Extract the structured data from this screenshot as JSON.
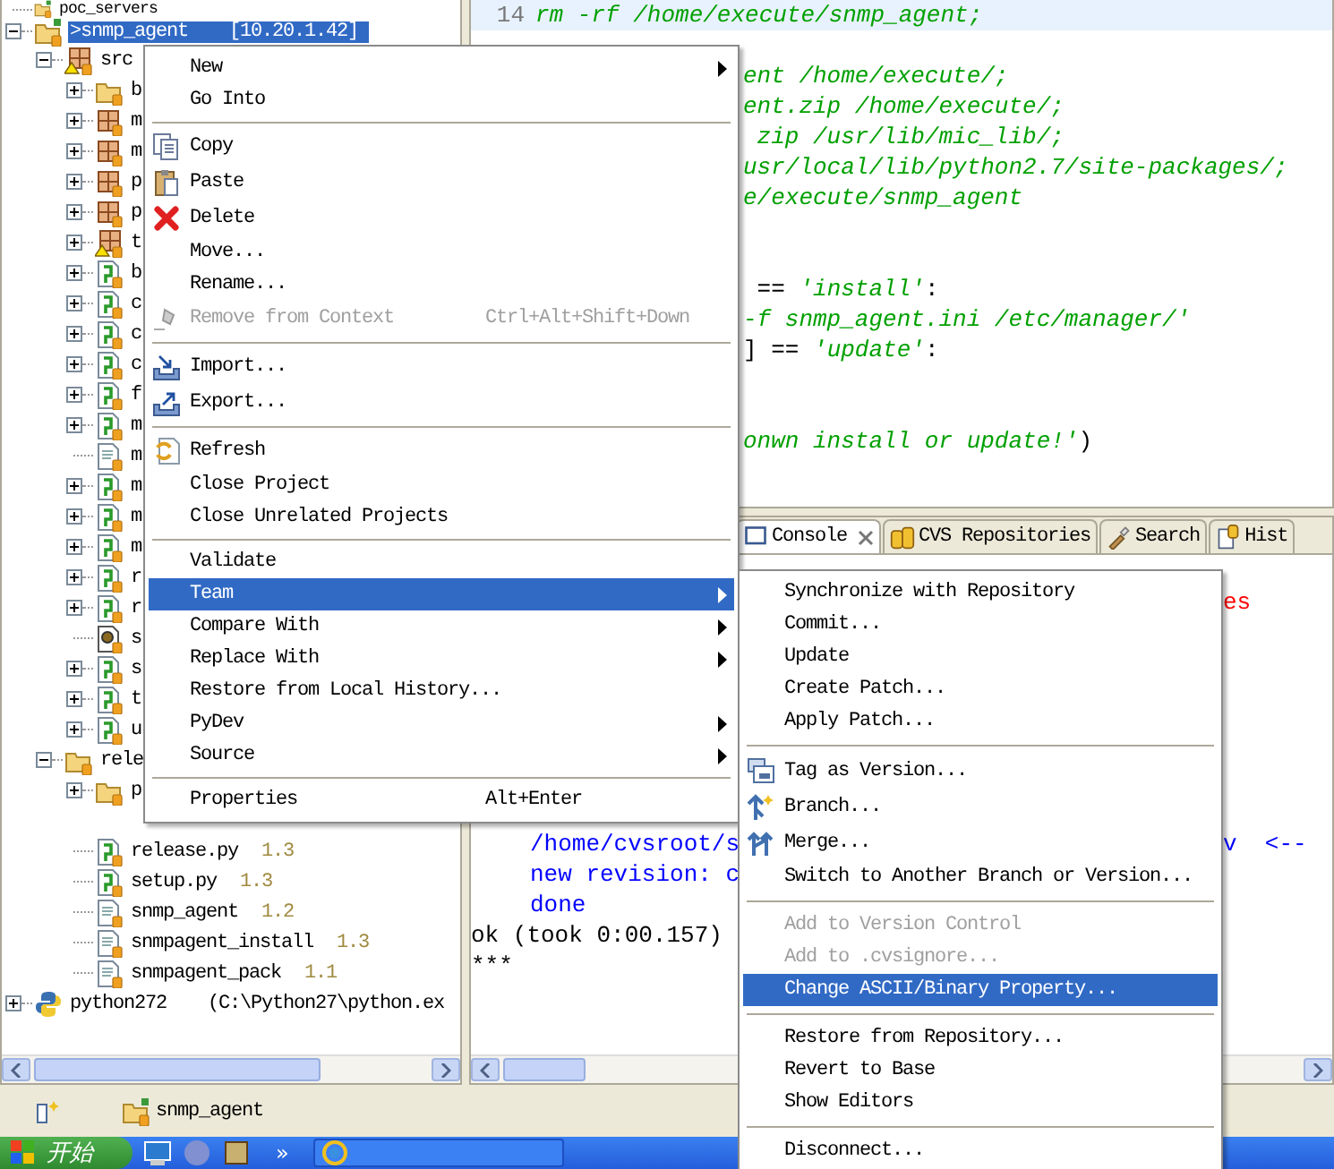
{
  "project_tree": {
    "items": [
      {
        "name": "poc_servers",
        "kind": "project",
        "selected": false
      },
      {
        "name": ">snmp_agent",
        "location": "[10.20.1.42]",
        "kind": "project",
        "expanded": true,
        "selected": true,
        "children": [
          {
            "name": "src",
            "kind": "package_warning",
            "expanded": true,
            "selected": false,
            "children": [
              {
                "name": "b",
                "kind": "folder",
                "expanded": false,
                "selected": false
              },
              {
                "name": "m",
                "kind": "package",
                "expanded": false,
                "selected": false
              },
              {
                "name": "m",
                "kind": "package",
                "expanded": false,
                "selected": false
              },
              {
                "name": "p",
                "kind": "package",
                "expanded": false,
                "selected": false
              },
              {
                "name": "p",
                "kind": "package",
                "expanded": false,
                "selected": false
              },
              {
                "name": "t",
                "kind": "package_warning",
                "expanded": false,
                "selected": false
              },
              {
                "name": "b",
                "kind": "module",
                "expanded": false,
                "selected": false
              },
              {
                "name": "c",
                "kind": "module",
                "expanded": false,
                "selected": false
              },
              {
                "name": "c",
                "kind": "module",
                "expanded": false,
                "selected": false
              },
              {
                "name": "c",
                "kind": "module",
                "expanded": false,
                "selected": false
              },
              {
                "name": "f",
                "kind": "module",
                "expanded": false,
                "selected": false
              },
              {
                "name": "m",
                "kind": "module",
                "expanded": false,
                "selected": false
              },
              {
                "name": "m",
                "kind": "file",
                "selected": false
              },
              {
                "name": "m",
                "kind": "module",
                "expanded": false,
                "selected": false
              },
              {
                "name": "m",
                "kind": "module",
                "expanded": false,
                "selected": false
              },
              {
                "name": "m",
                "kind": "module",
                "expanded": false,
                "selected": false
              },
              {
                "name": "r",
                "kind": "module",
                "expanded": false,
                "selected": false
              },
              {
                "name": "r",
                "kind": "module",
                "expanded": false,
                "selected": false
              },
              {
                "name": "s",
                "kind": "gear_file",
                "selected": false
              },
              {
                "name": "s",
                "kind": "module",
                "expanded": false,
                "selected": false
              },
              {
                "name": "t",
                "kind": "module",
                "expanded": false,
                "selected": false
              },
              {
                "name": "u",
                "kind": "module",
                "expanded": false,
                "selected": false
              }
            ]
          },
          {
            "name": "rele",
            "kind": "folder",
            "expanded": true,
            "selected": false,
            "children": [
              {
                "name": "p",
                "kind": "folder",
                "expanded": false,
                "selected": false
              },
              {
                "kind": "covered"
              },
              {
                "name": "release.py",
                "version": "1.3",
                "kind": "module",
                "selected": false
              },
              {
                "name": "setup.py",
                "version": "1.3",
                "kind": "module",
                "selected": false
              },
              {
                "name": "snmp_agent",
                "version": "1.2",
                "kind": "file",
                "selected": false
              },
              {
                "name": "snmpagent_install",
                "version": "1.3",
                "kind": "file",
                "selected": false
              },
              {
                "name": "snmpagent_pack",
                "version": "1.1",
                "kind": "file",
                "selected": false
              }
            ]
          }
        ]
      },
      {
        "name": "python272",
        "location": "(C:\\Python27\\python.ex",
        "kind": "python",
        "expanded": false,
        "selected": false
      }
    ]
  },
  "editor": {
    "lines": [
      {
        "kind": "current",
        "number": "14",
        "segments": [
          {
            "text": "rm -rf /home/execute/snmp_agent;",
            "kind": "string"
          }
        ]
      },
      {
        "kind": "blank"
      },
      {
        "kind": "clipped",
        "segments": [
          {
            "text": "ent /home/execute/;",
            "kind": "string"
          }
        ]
      },
      {
        "kind": "clipped",
        "segments": [
          {
            "text": "ent.zip /home/execute/;",
            "kind": "string"
          }
        ]
      },
      {
        "kind": "clipped",
        "segments": [
          {
            "text": " zip /usr/lib/mic_lib/;",
            "kind": "string"
          }
        ]
      },
      {
        "kind": "clipped",
        "segments": [
          {
            "text": "usr/local/lib/python2.7/site-packages/;",
            "kind": "string"
          }
        ]
      },
      {
        "kind": "clipped",
        "segments": [
          {
            "text": "e/execute/snmp_agent",
            "kind": "string"
          }
        ]
      },
      {
        "kind": "blank"
      },
      {
        "kind": "blank"
      },
      {
        "kind": "clipped",
        "segments": [
          {
            "text": " == ",
            "kind": "op"
          },
          {
            "text": "'install'",
            "kind": "string"
          },
          {
            "text": ":",
            "kind": "op"
          }
        ]
      },
      {
        "kind": "clipped",
        "segments": [
          {
            "text": "-f snmp_agent.ini /etc/manager/'",
            "kind": "string"
          }
        ]
      },
      {
        "kind": "clipped",
        "segments": [
          {
            "text": "] == ",
            "kind": "op"
          },
          {
            "text": "'update'",
            "kind": "string"
          },
          {
            "text": ":",
            "kind": "op"
          }
        ]
      },
      {
        "kind": "blank"
      },
      {
        "kind": "blank"
      },
      {
        "kind": "clipped",
        "segments": [
          {
            "text": "onwn install or update!'",
            "kind": "string"
          },
          {
            "text": ")",
            "kind": "op"
          }
        ]
      }
    ]
  },
  "console_view": {
    "tabs": [
      {
        "label": "Console",
        "kind": "console",
        "closable": true,
        "selected": true
      },
      {
        "label": "CVS Repositories",
        "kind": "repository",
        "closable": false,
        "selected": false
      },
      {
        "label": "Search",
        "kind": "search",
        "closable": false,
        "selected": false
      },
      {
        "label": "Hist",
        "kind": "history",
        "closable": false,
        "selected": false
      }
    ],
    "upper_lines": [
      {
        "segments": [
          {
            "text": "es",
            "kind": "right",
            "color": "#ff0000"
          }
        ]
      }
    ],
    "lower_lines": [
      {
        "segments": [
          {
            "text": "/home/cvsroot/s",
            "kind": "indent",
            "color": "#0000ff"
          },
          {
            "text": "v  <--",
            "kind": "right",
            "color": "#0000ff"
          }
        ]
      },
      {
        "segments": [
          {
            "text": "new revision: c",
            "kind": "indent",
            "color": "#0000ff"
          }
        ]
      },
      {
        "segments": [
          {
            "text": "done",
            "kind": "indent",
            "color": "#0000ff"
          }
        ]
      },
      {
        "segments": [
          {
            "text": "ok (took 0:00.157)",
            "kind": "start",
            "color": "#000000"
          }
        ]
      },
      {
        "segments": [
          {
            "text": "***",
            "kind": "start",
            "color": "#000000"
          }
        ]
      }
    ]
  },
  "context_menu": {
    "items": [
      {
        "kind": "plain",
        "label": "New",
        "submenu": true,
        "disabled": false,
        "selected": false
      },
      {
        "kind": "plain",
        "label": "Go Into",
        "submenu": false,
        "disabled": false,
        "selected": false
      },
      {
        "kind": "separator"
      },
      {
        "kind": "copy",
        "label": "Copy",
        "submenu": false,
        "disabled": false,
        "selected": false
      },
      {
        "kind": "paste",
        "label": "Paste",
        "submenu": false,
        "disabled": false,
        "selected": false
      },
      {
        "kind": "delete",
        "label": "Delete",
        "submenu": false,
        "disabled": false,
        "selected": false
      },
      {
        "kind": "plain",
        "label": "Move...",
        "submenu": false,
        "disabled": false,
        "selected": false
      },
      {
        "kind": "plain",
        "label": "Rename...",
        "submenu": false,
        "disabled": false,
        "selected": false
      },
      {
        "kind": "remove",
        "label": "Remove from Context",
        "shortcut": "Ctrl+Alt+Shift+Down",
        "submenu": false,
        "disabled": true,
        "selected": false
      },
      {
        "kind": "separator"
      },
      {
        "kind": "import",
        "label": "Import...",
        "submenu": false,
        "disabled": false,
        "selected": false
      },
      {
        "kind": "export",
        "label": "Export...",
        "submenu": false,
        "disabled": false,
        "selected": false
      },
      {
        "kind": "separator"
      },
      {
        "kind": "refresh",
        "label": "Refresh",
        "submenu": false,
        "disabled": false,
        "selected": false
      },
      {
        "kind": "plain",
        "label": "Close Project",
        "submenu": false,
        "disabled": false,
        "selected": false
      },
      {
        "kind": "plain",
        "label": "Close Unrelated Projects",
        "submenu": false,
        "disabled": false,
        "selected": false
      },
      {
        "kind": "separator"
      },
      {
        "kind": "plain",
        "label": "Validate",
        "submenu": false,
        "disabled": false,
        "selected": false
      },
      {
        "kind": "plain",
        "label": "Team",
        "submenu": true,
        "disabled": false,
        "selected": true
      },
      {
        "kind": "plain",
        "label": "Compare With",
        "submenu": true,
        "disabled": false,
        "selected": false
      },
      {
        "kind": "plain",
        "label": "Replace With",
        "submenu": true,
        "disabled": false,
        "selected": false
      },
      {
        "kind": "plain",
        "label": "Restore from Local History...",
        "submenu": false,
        "disabled": false,
        "selected": false
      },
      {
        "kind": "plain",
        "label": "PyDev",
        "submenu": true,
        "disabled": false,
        "selected": false
      },
      {
        "kind": "plain",
        "label": "Source",
        "submenu": true,
        "disabled": false,
        "selected": false
      },
      {
        "kind": "separator"
      },
      {
        "kind": "plain",
        "label": "Properties",
        "shortcut": "Alt+Enter",
        "submenu": false,
        "disabled": false,
        "selected": false
      }
    ]
  },
  "team_submenu": {
    "items": [
      {
        "kind": "plain",
        "label": "Synchronize with Repository",
        "submenu": false,
        "disabled": false,
        "selected": false
      },
      {
        "kind": "plain",
        "label": "Commit...",
        "submenu": false,
        "disabled": false,
        "selected": false
      },
      {
        "kind": "plain",
        "label": "Update",
        "submenu": false,
        "disabled": false,
        "selected": false
      },
      {
        "kind": "plain",
        "label": "Create Patch...",
        "submenu": false,
        "disabled": false,
        "selected": false
      },
      {
        "kind": "plain",
        "label": "Apply Patch...",
        "submenu": false,
        "disabled": false,
        "selected": false
      },
      {
        "kind": "separator"
      },
      {
        "kind": "tag",
        "label": "Tag as Version...",
        "submenu": false,
        "disabled": false,
        "selected": false
      },
      {
        "kind": "branch",
        "label": "Branch...",
        "submenu": false,
        "disabled": false,
        "selected": false
      },
      {
        "kind": "merge",
        "label": "Merge...",
        "submenu": false,
        "disabled": false,
        "selected": false
      },
      {
        "kind": "plain",
        "label": "Switch to Another Branch or Version...",
        "submenu": false,
        "disabled": false,
        "selected": false
      },
      {
        "kind": "separator"
      },
      {
        "kind": "plain",
        "label": "Add to Version Control",
        "submenu": false,
        "disabled": true,
        "selected": false
      },
      {
        "kind": "plain",
        "label": "Add to .cvsignore...",
        "submenu": false,
        "disabled": true,
        "selected": false
      },
      {
        "kind": "plain",
        "label": "Change ASCII/Binary Property...",
        "submenu": false,
        "disabled": false,
        "selected": true
      },
      {
        "kind": "separator"
      },
      {
        "kind": "plain",
        "label": "Restore from Repository...",
        "submenu": false,
        "disabled": false,
        "selected": false
      },
      {
        "kind": "plain",
        "label": "Revert to Base",
        "submenu": false,
        "disabled": false,
        "selected": false
      },
      {
        "kind": "plain",
        "label": "Show Editors",
        "submenu": false,
        "disabled": false,
        "selected": false
      },
      {
        "kind": "separator"
      },
      {
        "kind": "plain",
        "label": "Disconnect...",
        "submenu": false,
        "disabled": false,
        "selected": false
      }
    ]
  },
  "status_bar": {
    "project": "snmp_agent"
  },
  "taskbar": {
    "start": "开始",
    "overflow": "»"
  }
}
